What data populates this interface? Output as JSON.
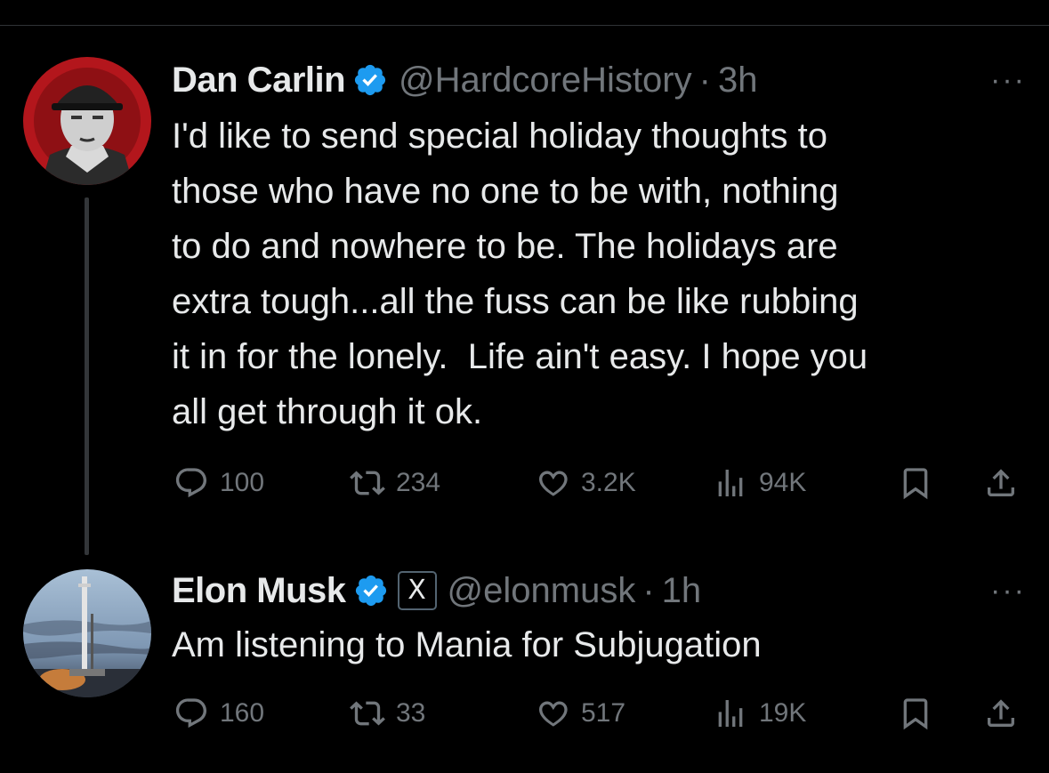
{
  "tweets": [
    {
      "author": "Dan Carlin",
      "handle": "@HardcoreHistory",
      "separator": "·",
      "time": "3h",
      "more": "···",
      "text": "I'd like to send special holiday thoughts to\nthose who have no one to be with, nothing\nto do and nowhere to be. The holidays are\nextra tough...all the fuss can be like rubbing\nit in for the lonely.  Life ain't easy. I hope you\nall get through it ok.",
      "replies": "100",
      "reposts": "234",
      "likes": "3.2K",
      "views": "94K"
    },
    {
      "author": "Elon Musk",
      "badge": "X",
      "handle": "@elonmusk",
      "separator": "·",
      "time": "1h",
      "more": "···",
      "text": "Am listening to Mania for Subjugation",
      "replies": "160",
      "reposts": "33",
      "likes": "517",
      "views": "19K"
    }
  ],
  "colors": {
    "background": "#000000",
    "text": "#e7e9ea",
    "muted": "#71767b",
    "verified": "#1d9bf0"
  },
  "icons": [
    "reply-icon",
    "repost-icon",
    "like-icon",
    "views-icon",
    "bookmark-icon",
    "share-icon",
    "verified-icon",
    "more-icon"
  ]
}
